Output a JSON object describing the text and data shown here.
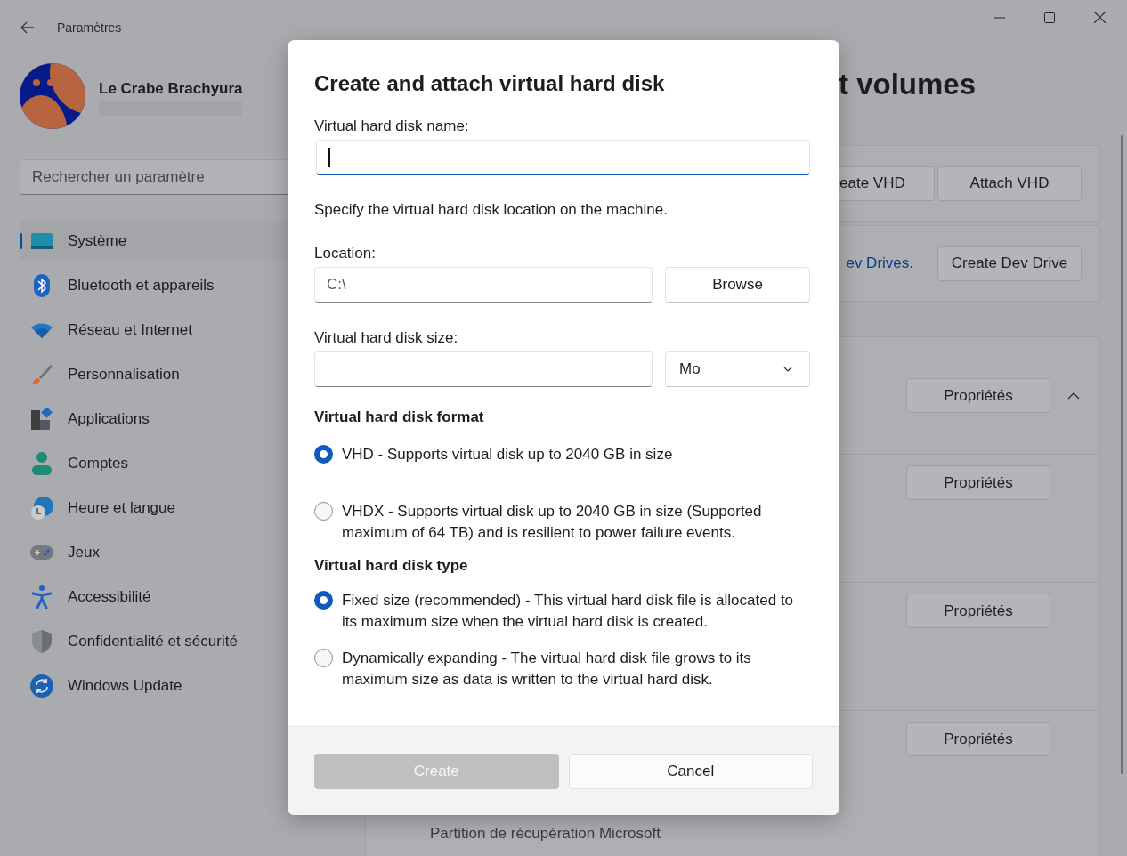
{
  "window": {
    "title": "Paramètres"
  },
  "profile": {
    "name": "Le Crabe Brachyura"
  },
  "search": {
    "placeholder": "Rechercher un paramètre"
  },
  "nav": [
    {
      "label": "Système",
      "selected": true
    },
    {
      "label": "Bluetooth et appareils",
      "selected": false
    },
    {
      "label": "Réseau et Internet",
      "selected": false
    },
    {
      "label": "Personnalisation",
      "selected": false
    },
    {
      "label": "Applications",
      "selected": false
    },
    {
      "label": "Comptes",
      "selected": false
    },
    {
      "label": "Heure et langue",
      "selected": false
    },
    {
      "label": "Jeux",
      "selected": false
    },
    {
      "label": "Accessibilité",
      "selected": false
    },
    {
      "label": "Confidentialité et sécurité",
      "selected": false
    },
    {
      "label": "Windows Update",
      "selected": false
    }
  ],
  "page": {
    "title": "t volumes",
    "vhd_buttons": [
      "eate VHD",
      "Attach VHD"
    ],
    "dev_drive": {
      "link": "ev Drives.",
      "button": "Create Dev Drive"
    },
    "drives": [
      {
        "button": "Propriétés",
        "expanded": true
      },
      {
        "button": "Propriétés"
      },
      {
        "button": "Propriétés"
      },
      {
        "button": "Propriétés",
        "lines": [
          "Partition de récupération Microsoft"
        ]
      }
    ]
  },
  "dialog": {
    "title": "Create and attach virtual hard disk",
    "name_label": "Virtual hard disk name:",
    "name_focused": true,
    "location_hint": "Specify the virtual hard disk location on the machine.",
    "location_label": "Location:",
    "location_value": "C:\\",
    "browse": "Browse",
    "size_label": "Virtual hard disk size:",
    "size_unit": "Mo",
    "format_heading": "Virtual hard disk format",
    "format_options": [
      {
        "label": "VHD - Supports virtual disk up to 2040 GB in size",
        "selected": true
      },
      {
        "label": "VHDX - Supports virtual disk up to 2040 GB in size (Supported maximum of 64 TB) and is resilient to power failure events.",
        "selected": false
      }
    ],
    "type_heading": "Virtual hard disk type",
    "type_options": [
      {
        "label": "Fixed size (recommended) - This virtual hard disk file is allocated to its maximum size when the virtual hard disk is created.",
        "selected": true
      },
      {
        "label": "Dynamically expanding - The virtual hard disk file grows to its maximum size as data is written to the virtual hard disk.",
        "selected": false
      }
    ],
    "buttons": [
      {
        "label": "Create",
        "disabled": true
      },
      {
        "label": "Cancel",
        "disabled": false
      }
    ]
  }
}
